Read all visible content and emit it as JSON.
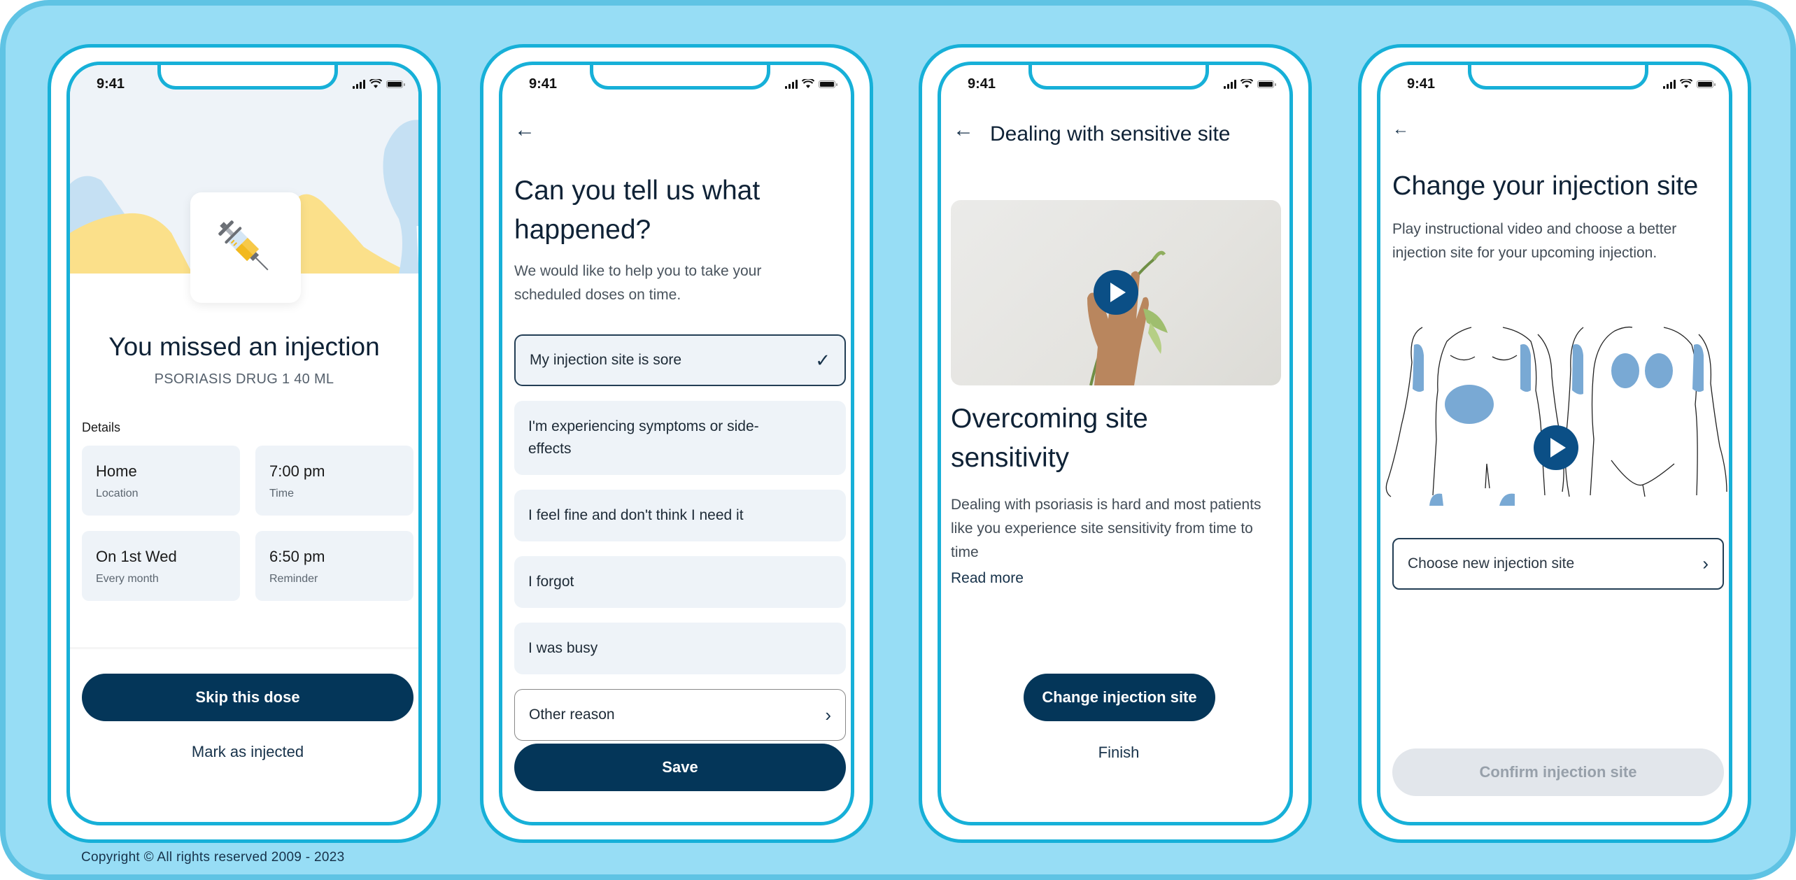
{
  "footer": {
    "copyright": "Copyright © All rights reserved 2009 - 2023"
  },
  "colors": {
    "background": "#97DDF5",
    "frame_border": "#17B0D8",
    "primary": "#043659",
    "play_button": "#0B4F86",
    "tile_bg": "#EEF3F8",
    "hero_yellow": "#FBE08A",
    "hero_blue": "#C5E0F3",
    "injection_zone": "#79A9D4"
  },
  "status_bar": {
    "time": "9:41"
  },
  "screens": [
    {
      "id": "missed-injection",
      "title": "You missed an injection",
      "subtitle": "PSORIASIS DRUG 1 40 ML",
      "illustration": "syringe-icon",
      "details_label": "Details",
      "details": [
        {
          "value": "Home",
          "caption": "Location"
        },
        {
          "value": "7:00 pm",
          "caption": "Time"
        },
        {
          "value": "On 1st Wed",
          "caption": "Every month"
        },
        {
          "value": "6:50 pm",
          "caption": "Reminder"
        }
      ],
      "primary_button": "Skip this dose",
      "secondary_button": "Mark as injected"
    },
    {
      "id": "tell-us-what-happened",
      "back_icon": "arrow-left-icon",
      "title": "Can you tell us what happened?",
      "subtitle": "We would like to help you to take your scheduled doses on time.",
      "options": [
        {
          "label": "My injection site is sore",
          "selected": true
        },
        {
          "label": "I'm experiencing symptoms or side-effects",
          "selected": false
        },
        {
          "label": "I feel fine and don't think I need it",
          "selected": false
        },
        {
          "label": "I forgot",
          "selected": false
        },
        {
          "label": "I was busy",
          "selected": false
        }
      ],
      "other_option": "Other reason",
      "primary_button": "Save"
    },
    {
      "id": "sensitive-site",
      "back_icon": "arrow-left-icon",
      "header": "Dealing with sensitive site",
      "video_icon": "play-icon",
      "title": "Overcoming site sensitivity",
      "body": "Dealing with psoriasis is hard and most patients like you experience site sensitivity from time to time",
      "read_more": "Read more",
      "primary_button": "Change injection site",
      "secondary_button": "Finish"
    },
    {
      "id": "change-injection-site",
      "back_icon": "arrow-left-icon",
      "title": "Change your injection site",
      "subtitle": "Play instructional video and choose a better injection site for your upcoming injection.",
      "video_icon": "play-icon",
      "choose_label": "Choose new injection site",
      "confirm_button": "Confirm injection site",
      "confirm_enabled": false
    }
  ]
}
